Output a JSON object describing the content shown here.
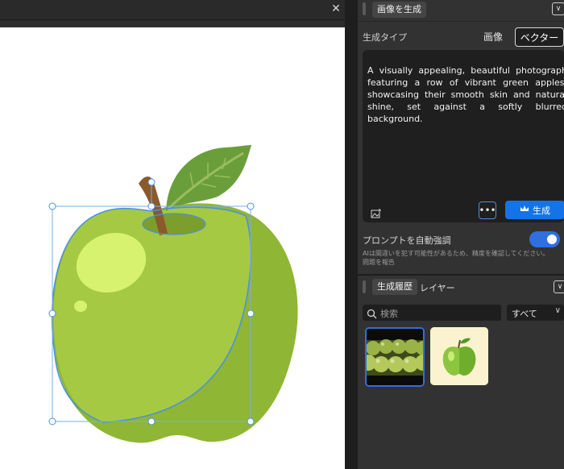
{
  "window": {
    "close_glyph": "✕"
  },
  "panel": {
    "header_tab": "画像を生成",
    "generation_type_label": "生成タイプ",
    "type_options": [
      "画像",
      "ベクター"
    ],
    "selected_type": "ベクター",
    "prompt_text": "A visually appealing, beautiful photograph featuring a row of vibrant green apples, showcasing their smooth skin and natural shine, set against a softly blurred background.",
    "more_label": "•••",
    "generate_label": "生成",
    "auto_enhance_label": "プロンプトを自動強調",
    "auto_enhance_on": true,
    "disclaimer": "AIは間違いを犯す可能性があるため、精度を確認してください。",
    "report_link": "問題を報告",
    "history_tab": "生成履歴",
    "layers_tab": "レイヤー",
    "search_placeholder": "検索",
    "filter_value": "すべて",
    "thumbnails": [
      "green-apples-photo",
      "green-apple-vector"
    ]
  },
  "colors": {
    "accent": "#1473e6",
    "apple_main": "#a4c940",
    "apple_shadow": "#8db232",
    "leaf": "#6a9e3a",
    "stem": "#8a5a2b",
    "highlight": "#d6f06c",
    "selection": "#4a90e2"
  },
  "icons": [
    "close-icon",
    "chevron-down-icon",
    "image-add-icon",
    "crown-icon",
    "search-icon"
  ]
}
